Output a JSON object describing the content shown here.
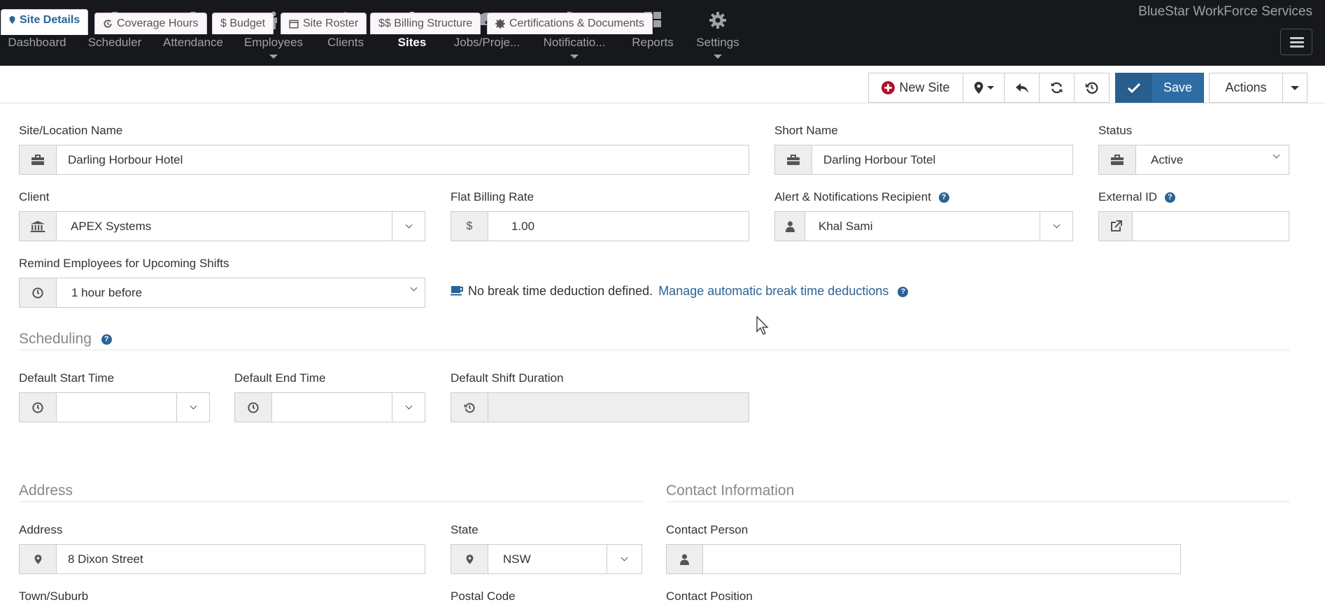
{
  "app": {
    "brand": "BlueStar WorkForce Services"
  },
  "nav": {
    "items": [
      {
        "label": "Dashboard",
        "icon": "home-icon"
      },
      {
        "label": "Scheduler",
        "icon": "clock-icon"
      },
      {
        "label": "Attendance",
        "icon": "clock-icon"
      },
      {
        "label": "Employees",
        "icon": "person-icon"
      },
      {
        "label": "Clients",
        "icon": "bank-icon"
      },
      {
        "label": "Sites",
        "icon": "map-marker-icon"
      },
      {
        "label": "Jobs/Proje...",
        "icon": "dashboard-icon"
      },
      {
        "label": "Notificatio...",
        "icon": "rss-icon"
      },
      {
        "label": "Reports",
        "icon": "grid-icon"
      },
      {
        "label": "Settings",
        "icon": "gear-icon"
      }
    ],
    "active": "Sites"
  },
  "tabs": [
    {
      "label": "Site Details",
      "icon": "map-marker-icon"
    },
    {
      "label": "Coverage Hours",
      "icon": "refresh-clock-icon"
    },
    {
      "label": "$ Budget",
      "icon": ""
    },
    {
      "label": "Site Roster",
      "icon": "calendar-icon"
    },
    {
      "label": "$$ Billing Structure",
      "icon": ""
    },
    {
      "label": "Certifications & Documents",
      "icon": "certificate-icon"
    }
  ],
  "toolbar": {
    "new_site": "New Site",
    "save": "Save",
    "actions": "Actions"
  },
  "form": {
    "site_name": {
      "label": "Site/Location Name",
      "value": "Darling Horbour Hotel"
    },
    "short_name": {
      "label": "Short Name",
      "value": "Darling Horbour Totel"
    },
    "status": {
      "label": "Status",
      "value": "Active"
    },
    "client": {
      "label": "Client",
      "value": "APEX Systems"
    },
    "flat_billing_rate": {
      "label": "Flat Billing Rate",
      "prefix": "$",
      "value": "1.00"
    },
    "alert_recipient": {
      "label": "Alert & Notifications Recipient",
      "value": "Khal Sami"
    },
    "external_id": {
      "label": "External ID",
      "value": ""
    },
    "remind": {
      "label": "Remind Employees for Upcoming Shifts",
      "value": "1 hour before"
    },
    "break_note": "No break time deduction defined.",
    "break_link": "Manage automatic break time deductions"
  },
  "scheduling": {
    "title": "Scheduling",
    "default_start": {
      "label": "Default Start Time",
      "value": ""
    },
    "default_end": {
      "label": "Default End Time",
      "value": ""
    },
    "default_duration": {
      "label": "Default Shift Duration",
      "value": ""
    }
  },
  "address": {
    "title": "Address",
    "address": {
      "label": "Address",
      "value": "8 Dixon Street"
    },
    "state": {
      "label": "State",
      "value": "NSW"
    },
    "town": {
      "label": "Town/Suburb"
    },
    "postal": {
      "label": "Postal Code"
    }
  },
  "contact": {
    "title": "Contact Information",
    "person": {
      "label": "Contact Person",
      "value": ""
    },
    "position": {
      "label": "Contact Position"
    }
  },
  "colors": {
    "nav_bg": "#16181c",
    "primary": "#2e6da4",
    "link": "#2a6496",
    "new_site_icon": "#b0112a"
  }
}
